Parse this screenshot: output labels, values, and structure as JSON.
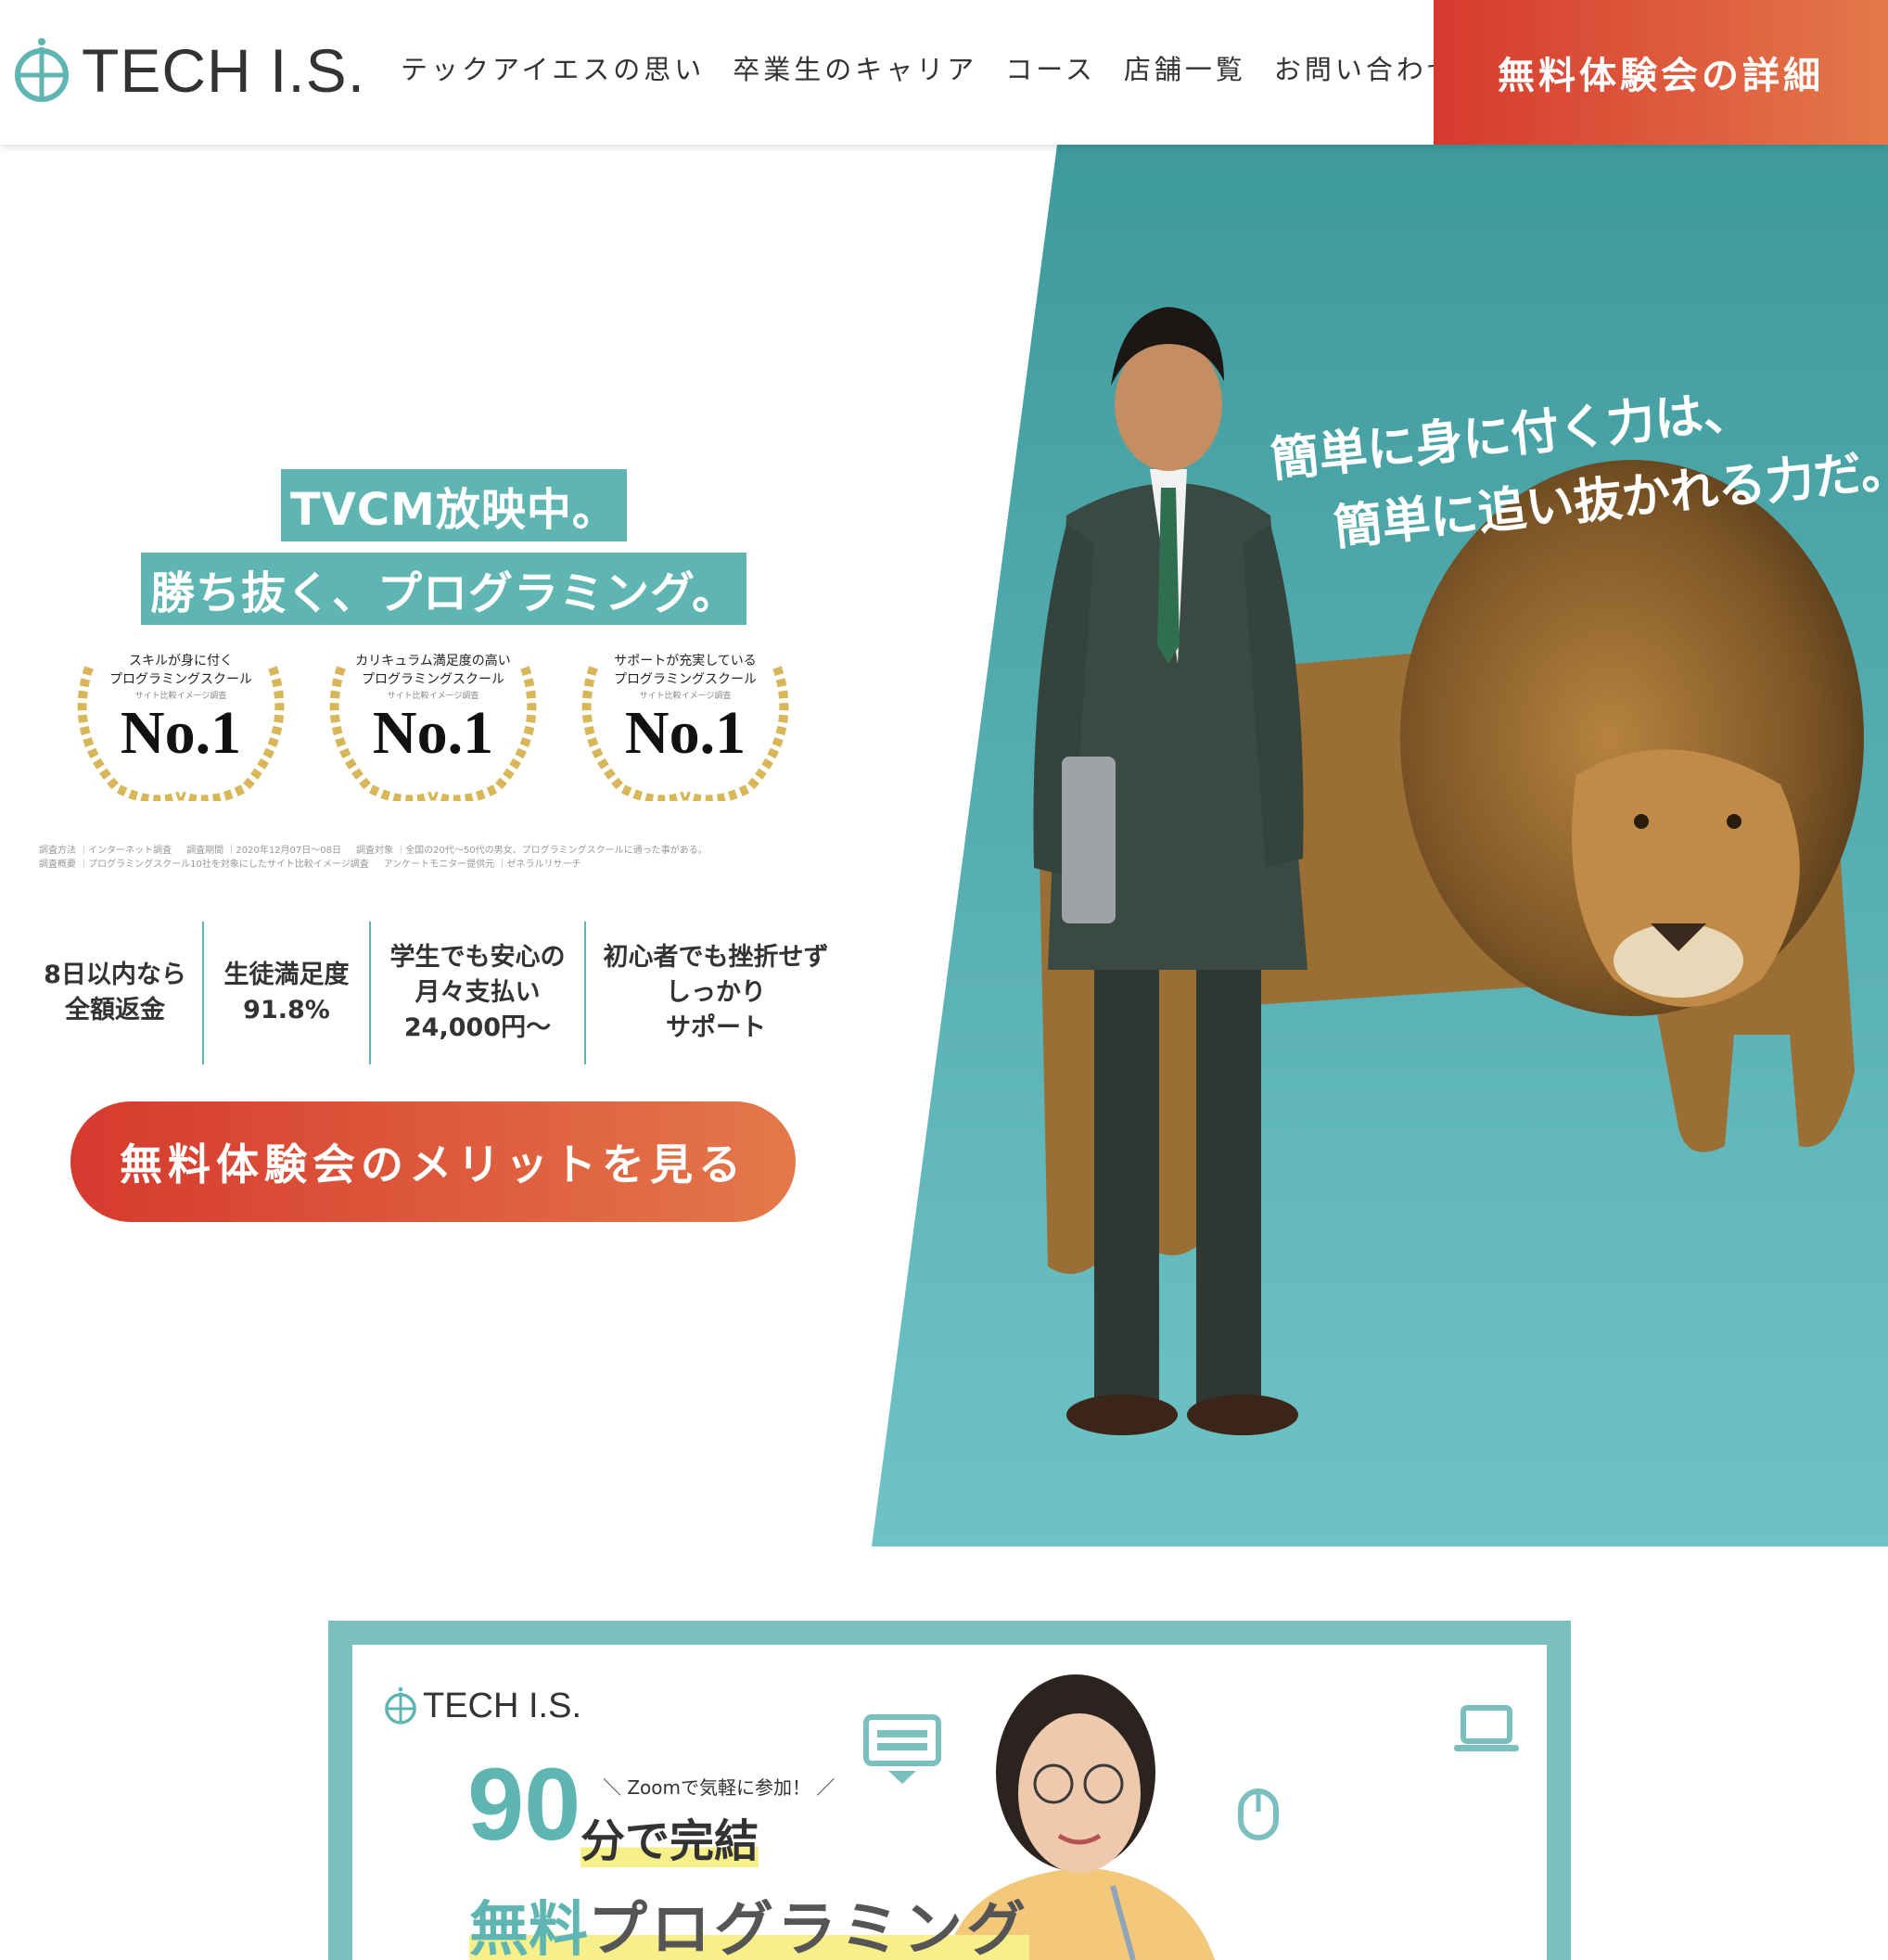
{
  "header": {
    "logo_text": "TECH I.S.",
    "nav": [
      "テックアイエスの思い",
      "卒業生のキャリア",
      "コース",
      "店舗一覧",
      "お問い合わせ"
    ],
    "cta_label": "無料体験会の詳細"
  },
  "hero": {
    "tag_line_1": "TVCM放映中。",
    "tag_line_2": "勝ち抜く、プログラミング。",
    "photo_copy_line_1": "簡単に身に付く力は、",
    "photo_copy_line_2": "簡単に追い抜かれる力だ。",
    "awards": [
      {
        "line1": "スキルが身に付く",
        "line2": "プログラミングスクール",
        "source": "サイト比較イメージ調査",
        "rank": "No.1"
      },
      {
        "line1": "カリキュラム満足度の高い",
        "line2": "プログラミングスクール",
        "source": "サイト比較イメージ調査",
        "rank": "No.1"
      },
      {
        "line1": "サポートが充実している",
        "line2": "プログラミングスクール",
        "source": "サイト比較イメージ調査",
        "rank": "No.1"
      }
    ],
    "survey": {
      "row1": [
        "調査方法 ｜インターネット調査",
        "調査期間 ｜2020年12月07日～08日",
        "調査対象 ｜全国の20代～50代の男女、プログラミングスクールに通った事がある。"
      ],
      "row2": [
        "調査概要 ｜プログラミングスクール10社を対象にしたサイト比較イメージ調査",
        "アンケートモニター提供元 ｜ゼネラルリサーチ"
      ]
    },
    "features": [
      {
        "line1": "8日以内なら",
        "line2": "全額返金",
        "line3": ""
      },
      {
        "line1": "生徒満足度",
        "line2": "91.8%",
        "line3": ""
      },
      {
        "line1": "学生でも安心の",
        "line2": "月々支払い",
        "line3": "24,000円〜"
      },
      {
        "line1": "初心者でも挫折せず",
        "line2": "しっかり",
        "line3": "サポート"
      }
    ],
    "cta_label": "無料体験会のメリットを見る"
  },
  "banner": {
    "logo_text": "TECH I.S.",
    "number": "90",
    "zoom_note": "＼ Zoomで気軽に参加！ ／",
    "minutes_text": "分で完結",
    "free_text": "無料",
    "programming_text": "プログラミング"
  },
  "colors": {
    "teal": "#5fb5b1",
    "cta_gradient_start": "#d63a2e",
    "cta_gradient_end": "#e4784a",
    "banner_frame": "#7cbfbf",
    "highlight_yellow": "#f6ef8a"
  },
  "icons": [
    "globe-logo-icon",
    "laurel-wreath-icon",
    "keyboard-icon",
    "laptop-icon",
    "mouse-icon"
  ]
}
